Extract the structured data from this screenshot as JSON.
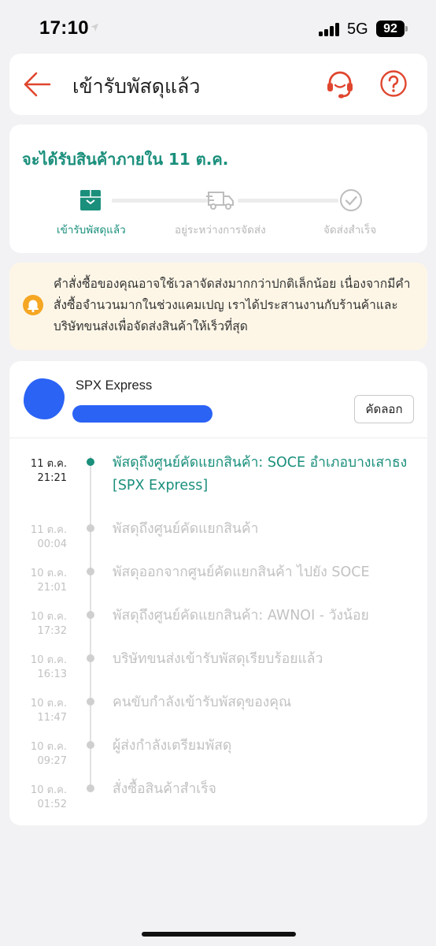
{
  "status_bar": {
    "time": "17:10",
    "network": "5G",
    "battery": "92"
  },
  "header": {
    "title": "เข้ารับพัสดุแล้ว",
    "icons": [
      "back-arrow-icon",
      "headset-icon",
      "help-icon"
    ],
    "accent_color": "#e0462f"
  },
  "progress": {
    "eta": "จะได้รับสินค้าภายใน 11 ต.ค.",
    "steps": [
      {
        "label": "เข้ารับพัสดุแล้ว",
        "icon": "package-icon",
        "state": "done"
      },
      {
        "label": "อยู่ระหว่างการจัดส่ง",
        "icon": "truck-icon",
        "state": "pending"
      },
      {
        "label": "จัดส่งสำเร็จ",
        "icon": "check-circle-icon",
        "state": "pending"
      }
    ],
    "accent_color": "#1a8f7c"
  },
  "notice": {
    "icon": "bell-icon",
    "text": "คำสั่งซื้อของคุณอาจใช้เวลาจัดส่งมากกว่าปกติเล็กน้อย เนื่องจากมีคำสั่งซื้อจำนวนมากในช่วงแคมเปญ เราได้ประสานงานกับร้านค้าและบริษัทขนส่งเพื่อจัดส่งสินค้าให้เร็วที่สุด",
    "background": "#fdf6e7"
  },
  "shipment": {
    "carrier": "SPX Express",
    "copy_label": "คัดลอก"
  },
  "events": [
    {
      "date": "11 ต.ค.",
      "time": "21:21",
      "description": "พัสดุถึงศูนย์คัดแยกสินค้า: SOCE อำเภอบางเสาธง [SPX Express]",
      "current": true
    },
    {
      "date": "11 ต.ค.",
      "time": "00:04",
      "description": "พัสดุถึงศูนย์คัดแยกสินค้า",
      "current": false
    },
    {
      "date": "10 ต.ค.",
      "time": "21:01",
      "description": "พัสดุออกจากศูนย์คัดแยกสินค้า ไปยัง SOCE",
      "current": false
    },
    {
      "date": "10 ต.ค.",
      "time": "17:32",
      "description": "พัสดุถึงศูนย์คัดแยกสินค้า: AWNOI - วังน้อย",
      "current": false
    },
    {
      "date": "10 ต.ค.",
      "time": "16:13",
      "description": "บริษัทขนส่งเข้ารับพัสดุเรียบร้อยแล้ว",
      "current": false
    },
    {
      "date": "10 ต.ค.",
      "time": "11:47",
      "description": "คนขับกำลังเข้ารับพัสดุของคุณ",
      "current": false
    },
    {
      "date": "10 ต.ค.",
      "time": "09:27",
      "description": "ผู้ส่งกำลังเตรียมพัสดุ",
      "current": false
    },
    {
      "date": "10 ต.ค.",
      "time": "01:52",
      "description": "สั่งซื้อสินค้าสำเร็จ",
      "current": false
    }
  ]
}
